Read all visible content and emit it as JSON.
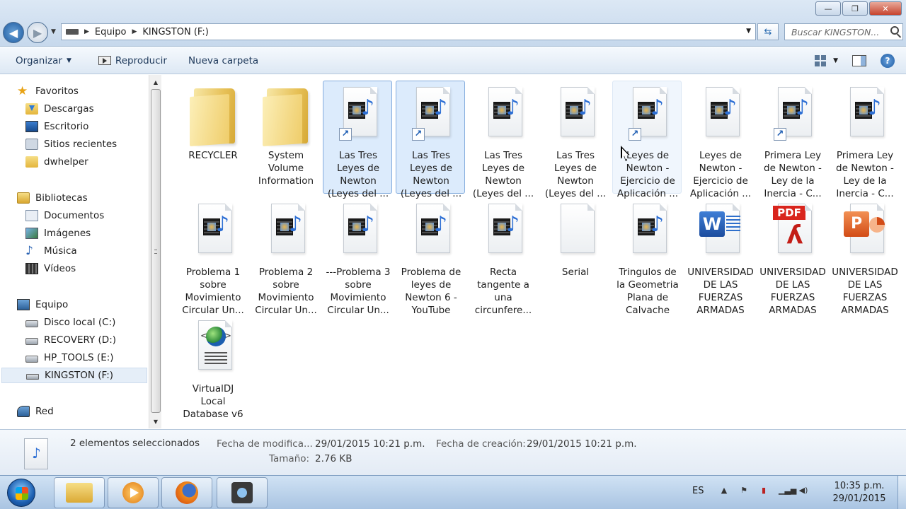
{
  "window": {
    "address": {
      "crumbs": [
        "Equipo",
        "KINGSTON (F:)"
      ]
    },
    "search": {
      "placeholder": "Buscar KINGSTON..."
    }
  },
  "toolbar": {
    "organize": "Organizar",
    "play": "Reproducir",
    "new_folder": "Nueva carpeta"
  },
  "nav": {
    "favorites": {
      "label": "Favoritos",
      "items": [
        "Descargas",
        "Escritorio",
        "Sitios recientes",
        "dwhelper"
      ]
    },
    "libraries": {
      "label": "Bibliotecas",
      "items": [
        "Documentos",
        "Imágenes",
        "Música",
        "Vídeos"
      ]
    },
    "computer": {
      "label": "Equipo",
      "items": [
        "Disco local (C:)",
        "RECOVERY (D:)",
        "HP_TOOLS (E:)",
        "KINGSTON (F:)"
      ]
    },
    "network": {
      "label": "Red"
    },
    "selected": "KINGSTON (F:)"
  },
  "files": [
    {
      "name": "RECYCLER",
      "type": "folder",
      "selected": false,
      "shortcut": false
    },
    {
      "name": "System Volume Information",
      "type": "folder",
      "selected": false,
      "shortcut": false
    },
    {
      "name": "Las Tres Leyes de Newton (Leyes del ...",
      "type": "media",
      "selected": true,
      "shortcut": true
    },
    {
      "name": "Las Tres Leyes de Newton (Leyes del ...",
      "type": "media",
      "selected": true,
      "shortcut": true
    },
    {
      "name": "Las Tres Leyes de Newton (Leyes del ...",
      "type": "media",
      "selected": false,
      "shortcut": false
    },
    {
      "name": "Las Tres Leyes de Newton (Leyes del ...",
      "type": "media",
      "selected": false,
      "shortcut": false
    },
    {
      "name": "Leyes de Newton - Ejercicio de Aplicación ...",
      "type": "media",
      "selected": false,
      "shortcut": true,
      "hovered": true
    },
    {
      "name": "Leyes de Newton - Ejercicio de Aplicación ...",
      "type": "media",
      "selected": false,
      "shortcut": false
    },
    {
      "name": "Primera Ley de Newton - Ley de la Inercia - C...",
      "type": "media",
      "selected": false,
      "shortcut": true
    },
    {
      "name": "Primera Ley de Newton - Ley de la Inercia - C...",
      "type": "media",
      "selected": false,
      "shortcut": false
    },
    {
      "name": "Problema 1 sobre Movimiento Circular Un...",
      "type": "media",
      "selected": false,
      "shortcut": false
    },
    {
      "name": "Problema 2 sobre Movimiento Circular Un...",
      "type": "media",
      "selected": false,
      "shortcut": false
    },
    {
      "name": "---Problema 3 sobre Movimiento Circular Un...",
      "type": "media",
      "selected": false,
      "shortcut": false
    },
    {
      "name": "Problema de leyes de Newton 6 - YouTube",
      "type": "media",
      "selected": false,
      "shortcut": false
    },
    {
      "name": "Recta tangente a una circunfere...",
      "type": "media",
      "selected": false,
      "shortcut": false
    },
    {
      "name": "Serial",
      "type": "blank",
      "selected": false,
      "shortcut": false
    },
    {
      "name": "Tringulos de la Geometria Plana de Calvache",
      "type": "media",
      "selected": false,
      "shortcut": false
    },
    {
      "name": "UNIVERSIDAD DE LAS FUERZAS ARMADAS",
      "type": "word",
      "selected": false,
      "shortcut": false
    },
    {
      "name": "UNIVERSIDAD DE LAS FUERZAS ARMADAS",
      "type": "pdf",
      "selected": false,
      "shortcut": false,
      "badge": "PDF"
    },
    {
      "name": "UNIVERSIDAD DE LAS FUERZAS ARMADAS",
      "type": "ppt",
      "selected": false,
      "shortcut": false
    },
    {
      "name": "VirtualDJ Local Database v6",
      "type": "html",
      "selected": false,
      "shortcut": false
    }
  ],
  "details": {
    "summary": "2 elementos seleccionados",
    "modified_label": "Fecha de modifica...",
    "modified_value": "29/01/2015 10:21 p.m.",
    "created_label": "Fecha de creación:",
    "created_value": "29/01/2015 10:21 p.m.",
    "size_label": "Tamaño:",
    "size_value": "2.76 KB"
  },
  "taskbar": {
    "lang": "ES",
    "time": "10:35 p.m.",
    "date": "29/01/2015"
  }
}
